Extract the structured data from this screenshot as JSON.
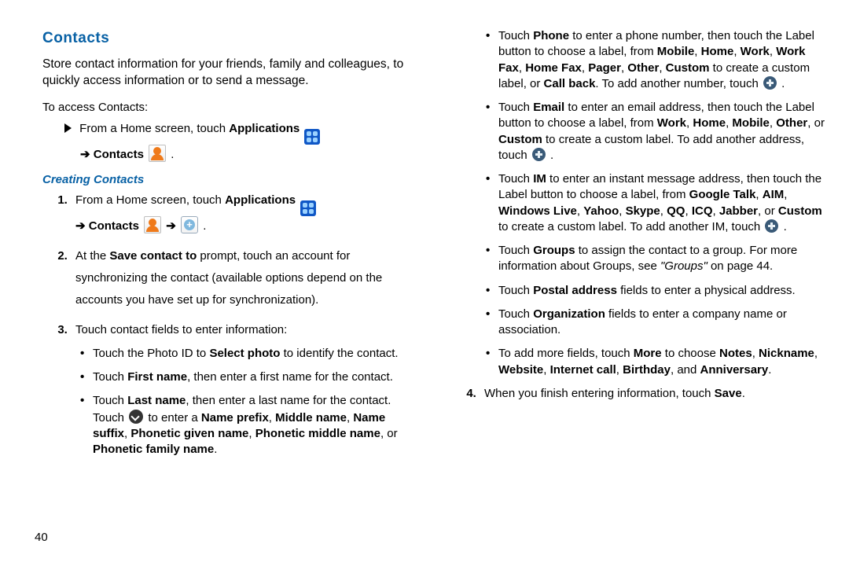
{
  "page_number": "40",
  "left": {
    "heading": "Contacts",
    "intro": "Store contact information for your friends, family and colleagues, to quickly access information or to send a message.",
    "access_lead": "To access Contacts:",
    "access_line_a": "From a Home screen, touch ",
    "access_apps": "Applications",
    "access_line_b": " ",
    "access_arrow": "➔",
    "access_contacts": "Contacts",
    "access_end": " .",
    "sub": "Creating Contacts",
    "s1_a": "From a Home screen, touch ",
    "s1_apps": "Applications",
    "s1_arrow": "➔",
    "s1_contacts": "Contacts",
    "s1_arrow2": "➔",
    "s1_end": " .",
    "s2_a": "At the ",
    "s2_b": "Save contact to",
    "s2_c": " prompt, touch an account for synchronizing the contact (available options depend on the accounts you have set up for synchronization).",
    "s3": "Touch contact fields to enter information:",
    "b1_a": "Touch the Photo ID to ",
    "b1_b": "Select photo",
    "b1_c": " to identify the contact.",
    "b2_a": "Touch ",
    "b2_b": "First name",
    "b2_c": ", then enter a first name for the contact.",
    "b3_a": "Touch ",
    "b3_b": "Last name",
    "b3_c": ", then enter a last name for the contact. Touch ",
    "b3_d": " to enter a ",
    "b3_e": "Name prefix",
    "b3_f": ", ",
    "b3_g": "Middle name",
    "b3_h": ", ",
    "b3_i": "Name suffix",
    "b3_j": ", ",
    "b3_k": "Phonetic given name",
    "b3_l": ", ",
    "b3_m": "Phonetic middle name",
    "b3_n": ", or ",
    "b3_o": "Phonetic family name",
    "b3_p": "."
  },
  "right": {
    "r1_a": "Touch ",
    "r1_b": "Phone",
    "r1_c": " to enter a phone number, then touch the Label button to choose a label, from ",
    "r1_d": "Mobile",
    "r1_e": "Home",
    "r1_f": "Work",
    "r1_g": "Work Fax",
    "r1_h": "Home Fax",
    "r1_i": "Pager",
    "r1_j": "Other",
    "r1_k": "Custom",
    "r1_l": " to create a custom label, or ",
    "r1_m": "Call back",
    "r1_n": ". To add another number, touch ",
    "r1_o": " .",
    "r2_a": "Touch ",
    "r2_b": "Email",
    "r2_c": " to enter an email address, then touch the Label button to choose a label, from ",
    "r2_d": "Work",
    "r2_e": "Home",
    "r2_f": "Mobile",
    "r2_g": "Other",
    "r2_h": ", or ",
    "r2_i": "Custom",
    "r2_j": " to create a custom label. To add another address, touch ",
    "r2_k": " .",
    "r3_a": "Touch ",
    "r3_b": "IM",
    "r3_c": " to enter an instant message address, then touch the Label button to choose a label, from ",
    "r3_d": "Google Talk",
    "r3_e": "AIM",
    "r3_f": "Windows Live",
    "r3_g": "Yahoo",
    "r3_h": "Skype",
    "r3_i": "QQ",
    "r3_j": "ICQ",
    "r3_k": "Jabber",
    "r3_l": ", or ",
    "r3_m": "Custom",
    "r3_n": " to create a custom label. To add another IM, touch ",
    "r3_o": " .",
    "r4_a": "Touch ",
    "r4_b": "Groups",
    "r4_c": " to assign the contact to a group. For more information about Groups, see ",
    "r4_d": "\"Groups\"",
    "r4_e": " on page 44.",
    "r5_a": "Touch ",
    "r5_b": "Postal address",
    "r5_c": " fields to enter a physical address.",
    "r6_a": "Touch ",
    "r6_b": "Organization",
    "r6_c": " fields to enter a company name or association.",
    "r7_a": "To add more fields, touch ",
    "r7_b": "More",
    "r7_c": " to choose ",
    "r7_d": "Notes",
    "r7_e": "Nickname",
    "r7_f": "Website",
    "r7_g": "Internet call",
    "r7_h": "Birthday",
    "r7_i": ", and ",
    "r7_j": "Anniversary",
    "r7_k": ".",
    "s4_a": "When you finish entering information, touch ",
    "s4_b": "Save",
    "s4_c": "."
  },
  "sep": ", "
}
